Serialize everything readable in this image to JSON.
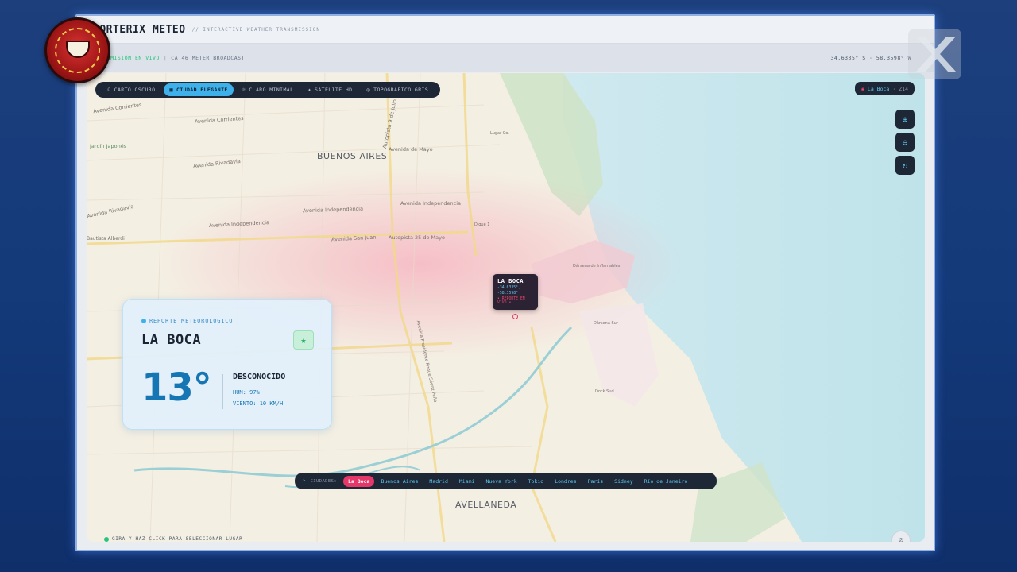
{
  "header": {
    "title": "VORTERIX METEO",
    "subtitle": "// INTERACTIVE WEATHER TRANSMISSION"
  },
  "status": {
    "live": "TRANSMISIÓN EN VIVO",
    "separator": "|",
    "broadcast": "CA 46 METER BROADCAST",
    "coords": "34.6335° S · 58.3598° W"
  },
  "map_styles": [
    {
      "icon": "moon-icon",
      "label": "CARTO OSCURO",
      "active": false
    },
    {
      "icon": "building-icon",
      "label": "CIUDAD ELEGANTE",
      "active": true
    },
    {
      "icon": "sun-icon",
      "label": "CLARO MINIMAL",
      "active": false
    },
    {
      "icon": "satellite-icon",
      "label": "SATÉLITE HD",
      "active": false
    },
    {
      "icon": "globe-icon",
      "label": "TOPOGRÁFICO GRIS",
      "active": false
    }
  ],
  "location_badge": {
    "place": "La Boca",
    "zoom": "Z14"
  },
  "map_labels": {
    "buenos_aires": "BUENOS AIRES",
    "avellaneda": "AVELLANEDA",
    "streets": [
      "Avenida Corrientes",
      "Avenida Corrientes",
      "Avenida Rivadavia",
      "Avenida de Mayo",
      "Avenida Independencia",
      "Avenida Independencia",
      "Avenida Independencia",
      "Avenida San Juan",
      "Autopista 25 de Mayo",
      "Avenida Rivadavia",
      "Autopista 9 de Julio",
      "Avenida Presidente Roque Sáenz Peña",
      "Jardín Japonés",
      "Dique 1",
      "Dársena de Inflamables",
      "Dock Sud",
      "Dársena Sur",
      "Bautista Alberdi",
      "Lugar Co."
    ]
  },
  "weather_card": {
    "tag": "REPORTE METEOROLÓGICO",
    "place": "LA BOCA",
    "temperature": "13°",
    "condition": "DESCONOCIDO",
    "humidity": "HUM: 97%",
    "wind": "VIENTO: 10 KM/H"
  },
  "marker": {
    "title": "LA BOCA",
    "lat": "-34.6335°,",
    "lon": "-58.3598°",
    "live": "• REPORTE EN VIVO •"
  },
  "hint": "GIRA Y HAZ CLICK PARA SELECCIONAR LUGAR",
  "city_bar": {
    "label": "CIUDADES:",
    "cities": [
      {
        "name": "La Boca",
        "active": true
      },
      {
        "name": "Buenos Aires",
        "active": false
      },
      {
        "name": "Madrid",
        "active": false
      },
      {
        "name": "Miami",
        "active": false
      },
      {
        "name": "Nueva York",
        "active": false
      },
      {
        "name": "Tokio",
        "active": false
      },
      {
        "name": "Londres",
        "active": false
      },
      {
        "name": "París",
        "active": false
      },
      {
        "name": "Sidney",
        "active": false
      },
      {
        "name": "Río de Janeiro",
        "active": false
      }
    ]
  },
  "logos": {
    "left": "NO PREGUNTES POR ESTO VORTERIX",
    "right": "VORTERIX"
  },
  "colors": {
    "accent": "#3fb1ea",
    "live": "#27c47d",
    "active_city": "#e5386a",
    "panel_dark": "#1e2735"
  }
}
